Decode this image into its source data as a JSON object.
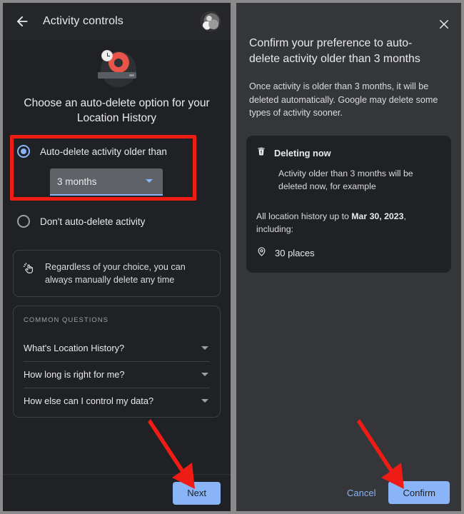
{
  "left_panel": {
    "header": {
      "back_icon": "back-arrow-icon",
      "title": "Activity controls",
      "avatar": "user-avatar"
    },
    "hero": {
      "illustration": "location-pin-clock-illustration",
      "heading": "Choose an auto-delete option for your Location History"
    },
    "options": [
      {
        "id": "auto-delete",
        "label": "Auto-delete activity older than",
        "selected": true,
        "dropdown": {
          "value": "3 months",
          "icon": "chevron-down-icon"
        }
      },
      {
        "id": "dont-auto-delete",
        "label": "Don't auto-delete activity",
        "selected": false
      }
    ],
    "notice_card": {
      "icon": "tap-hand-icon",
      "text": "Regardless of your choice, you can always manually delete any time"
    },
    "faq": {
      "title": "COMMON QUESTIONS",
      "items": [
        {
          "question": "What's Location History?",
          "icon": "chevron-down-icon"
        },
        {
          "question": "How long is right for me?",
          "icon": "chevron-down-icon"
        },
        {
          "question": "How else can I control my data?",
          "icon": "chevron-down-icon"
        }
      ]
    },
    "footer": {
      "next_label": "Next"
    }
  },
  "right_panel": {
    "close_icon": "close-icon",
    "heading": "Confirm your preference to auto-delete activity older than 3 months",
    "body": "Once activity is older than 3 months, it will be deleted automatically. Google may delete some types of activity sooner.",
    "deleting_card": {
      "icon": "trash-icon",
      "title": "Deleting now",
      "subtitle": "Activity older than 3 months will be deleted now, for example",
      "summary_prefix": "All location history up to ",
      "summary_date": "Mar 30, 2023",
      "summary_suffix": ", including:",
      "place_icon": "location-pin-icon",
      "place_count": "30 places"
    },
    "footer": {
      "cancel_label": "Cancel",
      "confirm_label": "Confirm"
    }
  },
  "annotations": {
    "highlight_box": "red-highlight-auto-delete-option",
    "arrow_next": "red-arrow-pointing-to-next-button",
    "arrow_confirm": "red-arrow-pointing-to-confirm-button"
  },
  "colors": {
    "accent_blue": "#8ab4f8",
    "annotation_red": "#ee1c15",
    "left_bg": "#202124",
    "right_bg": "#35363a",
    "pin_red": "#e8534a"
  }
}
